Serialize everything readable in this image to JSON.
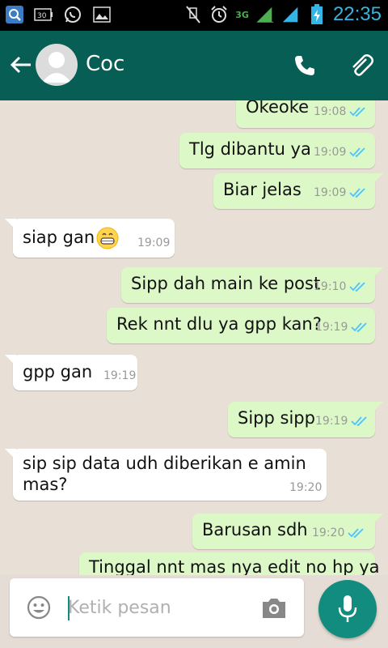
{
  "status_bar": {
    "time": "22:35",
    "network": "3G",
    "icons": [
      "search-icon",
      "battery-30-icon",
      "whatsapp-icon",
      "image-icon",
      "muted-icon",
      "alarm-icon",
      "signal-icon",
      "charging-battery-icon"
    ]
  },
  "header": {
    "contact_name": "Coc",
    "icons": [
      "back-arrow-icon",
      "avatar",
      "phone-icon",
      "attach-icon"
    ]
  },
  "messages": [
    {
      "dir": "out",
      "text": "Okeoke",
      "time": "19:08",
      "read": true
    },
    {
      "dir": "out",
      "text": "Tlg dibantu ya",
      "time": "19:09",
      "read": true
    },
    {
      "dir": "out",
      "text": "Biar jelas",
      "time": "19:09",
      "read": true
    },
    {
      "dir": "in",
      "text": "siap gan",
      "emoji": "grin",
      "time": "19:09"
    },
    {
      "dir": "out",
      "text": "Sipp dah main ke post",
      "time": "19:10",
      "read": true
    },
    {
      "dir": "out",
      "text": "Rek nnt dlu ya gpp kan?",
      "time": "19:19",
      "read": true
    },
    {
      "dir": "in",
      "text": "gpp gan",
      "time": "19:19"
    },
    {
      "dir": "out",
      "text": "Sipp sipp",
      "time": "19:19",
      "read": true
    },
    {
      "dir": "in",
      "lines": [
        "sip sip data udh diberikan e amin",
        "mas?"
      ],
      "time": "19:20"
    },
    {
      "dir": "out",
      "text": "Barusan sdh",
      "time": "19:20",
      "read": true
    },
    {
      "dir": "out",
      "text": "Tinggal nnt mas nya edit no hp ya",
      "time": "",
      "read": false
    }
  ],
  "composer": {
    "placeholder": "Ketik pesan",
    "icons": [
      "emoji-icon",
      "camera-icon",
      "mic-icon"
    ]
  },
  "colors": {
    "header": "#075e54",
    "outgoing_bubble": "#dcf8c6",
    "incoming_bubble": "#ffffff",
    "read_ticks": "#4fc3f7",
    "accent": "#128c7e",
    "clock": "#33b5e5"
  }
}
